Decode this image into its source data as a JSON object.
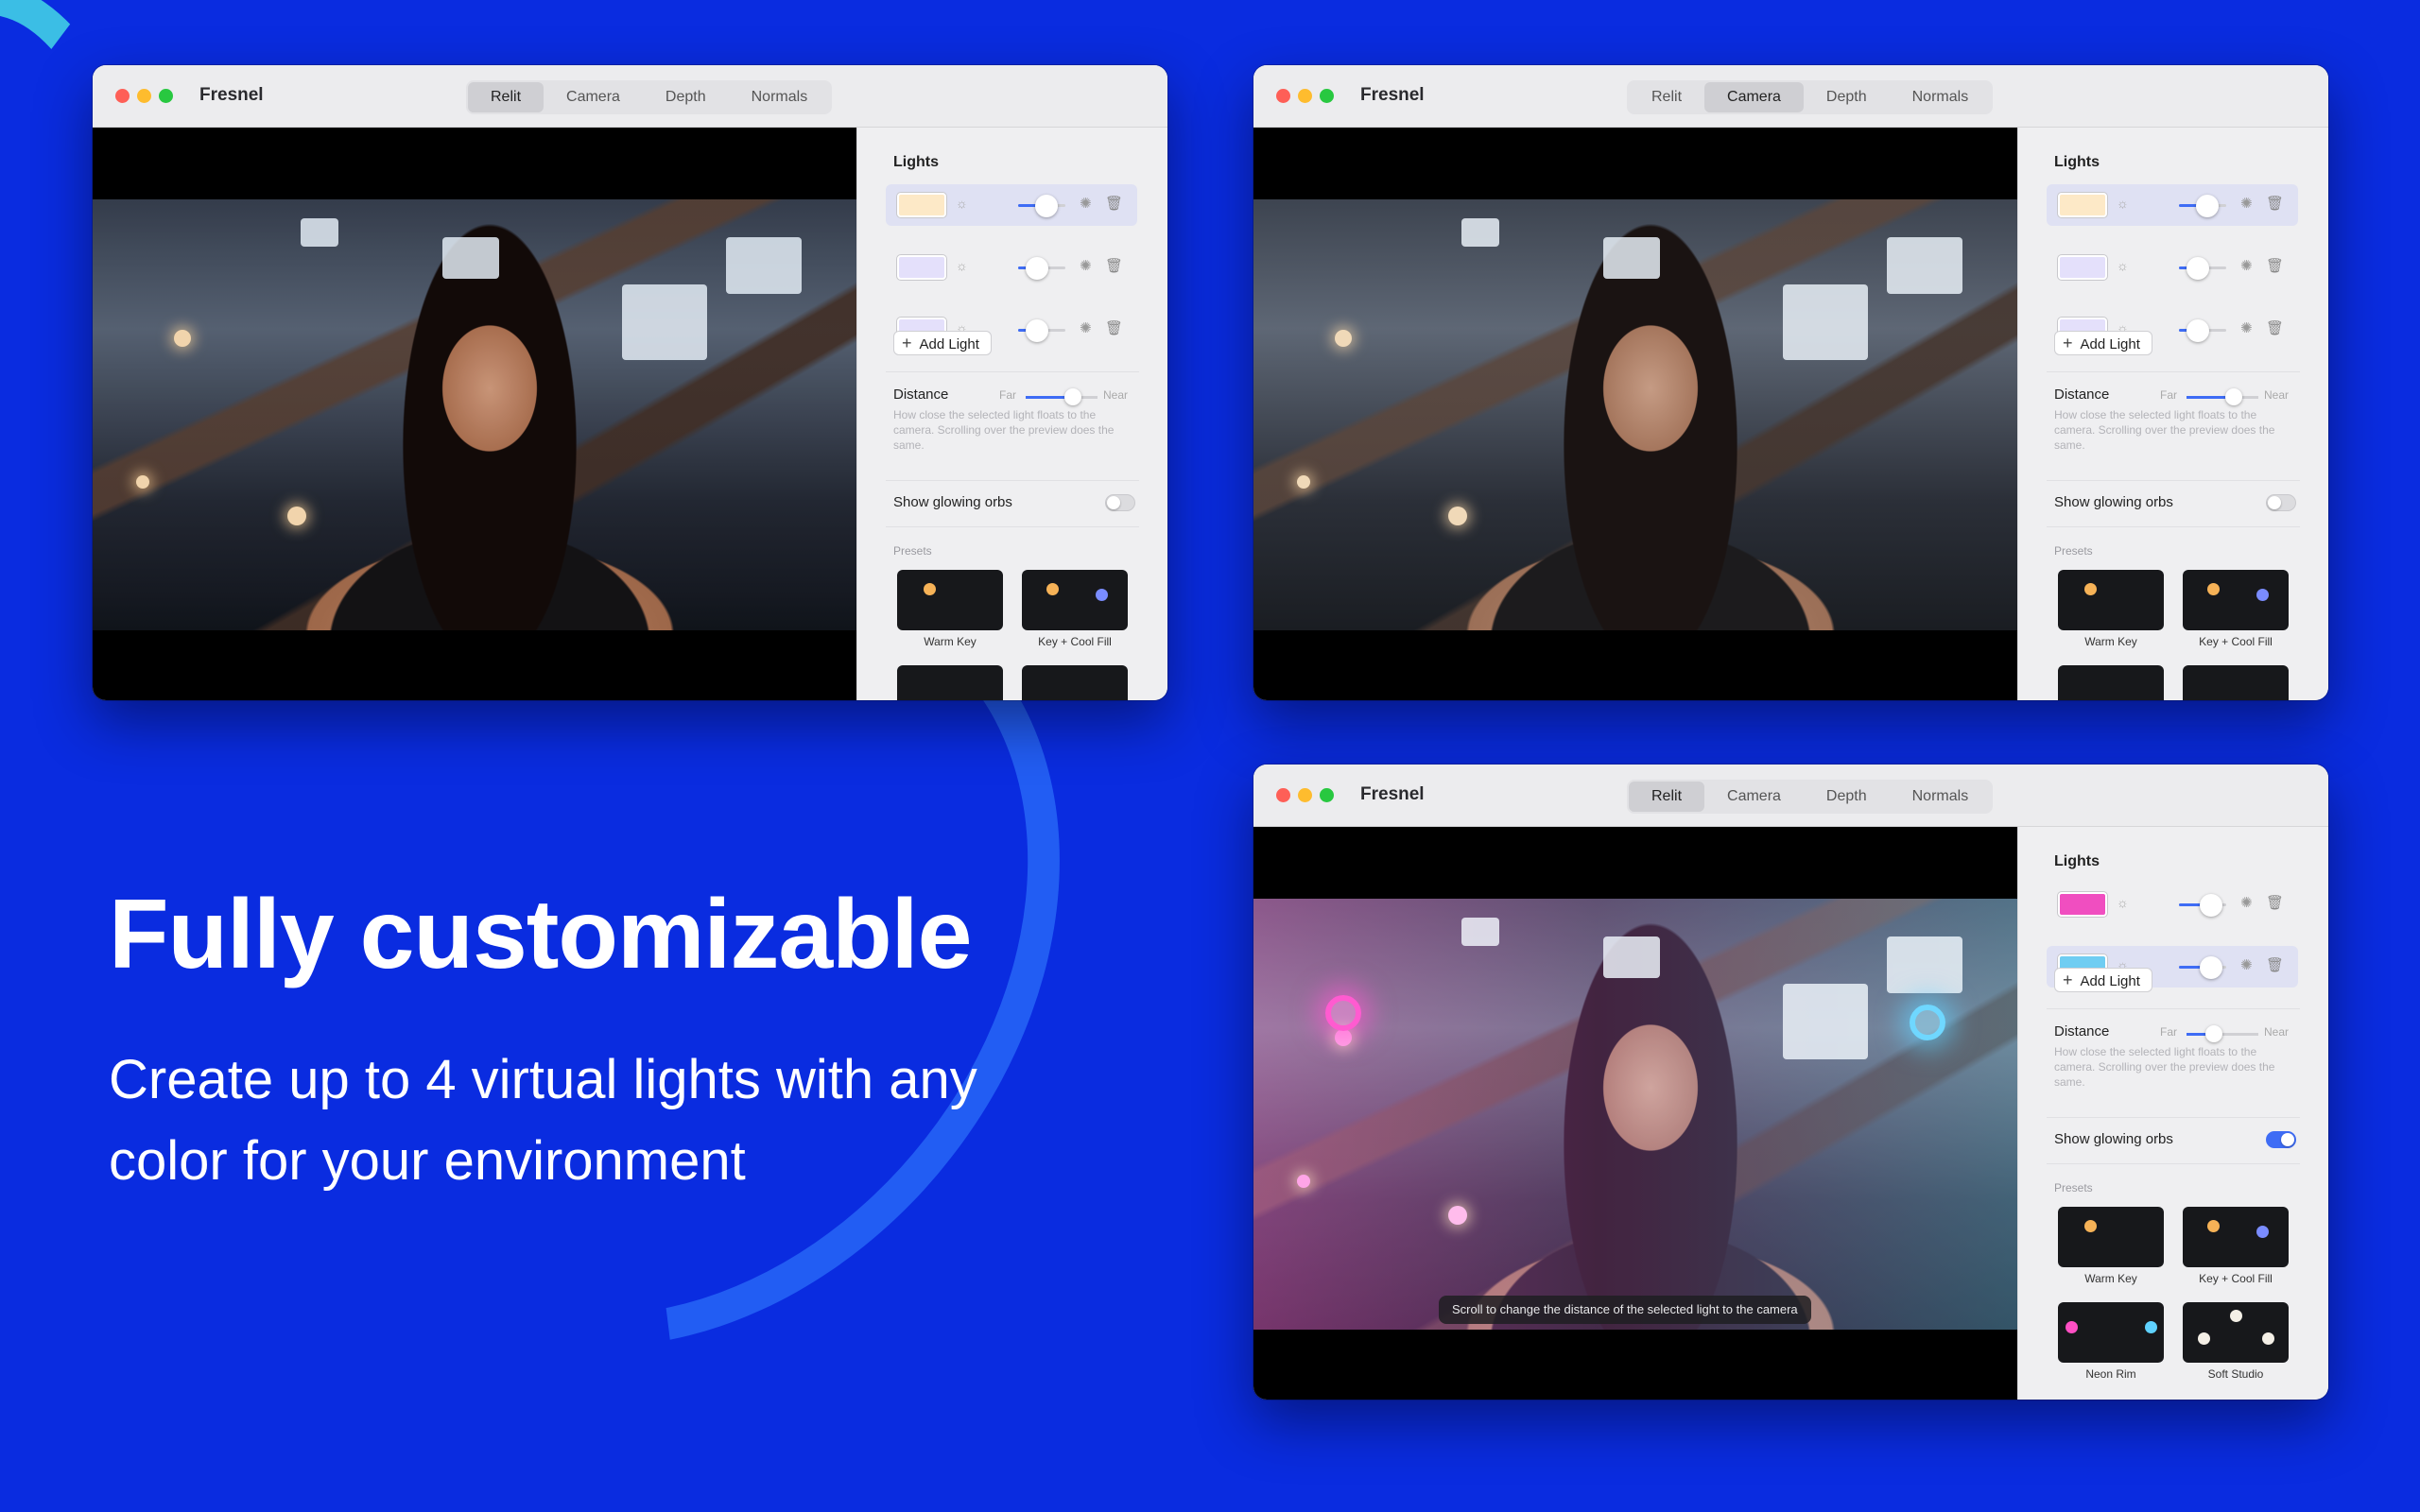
{
  "hero": {
    "headline": "Fully customizable",
    "subhead": "Create up to 4 virtual lights with any color for your environment"
  },
  "app": {
    "title": "Fresnel",
    "tabs": [
      "Relit",
      "Camera",
      "Depth",
      "Normals"
    ]
  },
  "panel": {
    "lights_title": "Lights",
    "add_light": "Add Light",
    "distance": "Distance",
    "far": "Far",
    "near": "Near",
    "distance_desc": "How close the selected light floats to the camera. Scrolling over the preview does the same.",
    "show_orbs": "Show glowing orbs",
    "presets_title": "Presets",
    "presets": [
      {
        "name": "Warm Key"
      },
      {
        "name": "Key + Cool Fill"
      },
      {
        "name": "Neon Rim"
      },
      {
        "name": "Soft Studio"
      }
    ]
  },
  "windows": [
    {
      "active_tab": "Relit",
      "lights": [
        {
          "color": "#fde9c7",
          "level": 0.8,
          "selected": true
        },
        {
          "color": "#e4e0fb",
          "level": 0.45,
          "selected": false
        },
        {
          "color": "#e4e0fb",
          "level": 0.45,
          "selected": false
        }
      ],
      "distance": 0.65,
      "orbs": false
    },
    {
      "active_tab": "Camera",
      "lights": [
        {
          "color": "#fde9c7",
          "level": 0.8,
          "selected": true
        },
        {
          "color": "#e4e0fb",
          "level": 0.45,
          "selected": false
        },
        {
          "color": "#e4e0fb",
          "level": 0.45,
          "selected": false
        }
      ],
      "distance": 0.65,
      "orbs": false
    },
    {
      "active_tab": "Relit",
      "lights": [
        {
          "color": "#f04ec0",
          "level": 0.85,
          "selected": false
        },
        {
          "color": "#6fcdf2",
          "level": 0.85,
          "selected": true
        }
      ],
      "distance": 0.35,
      "orbs": true,
      "hint": "Scroll to change the distance of the selected light to the camera"
    }
  ],
  "colors": {
    "background": "#0a2ce0",
    "accent": "#3e6cf5"
  }
}
